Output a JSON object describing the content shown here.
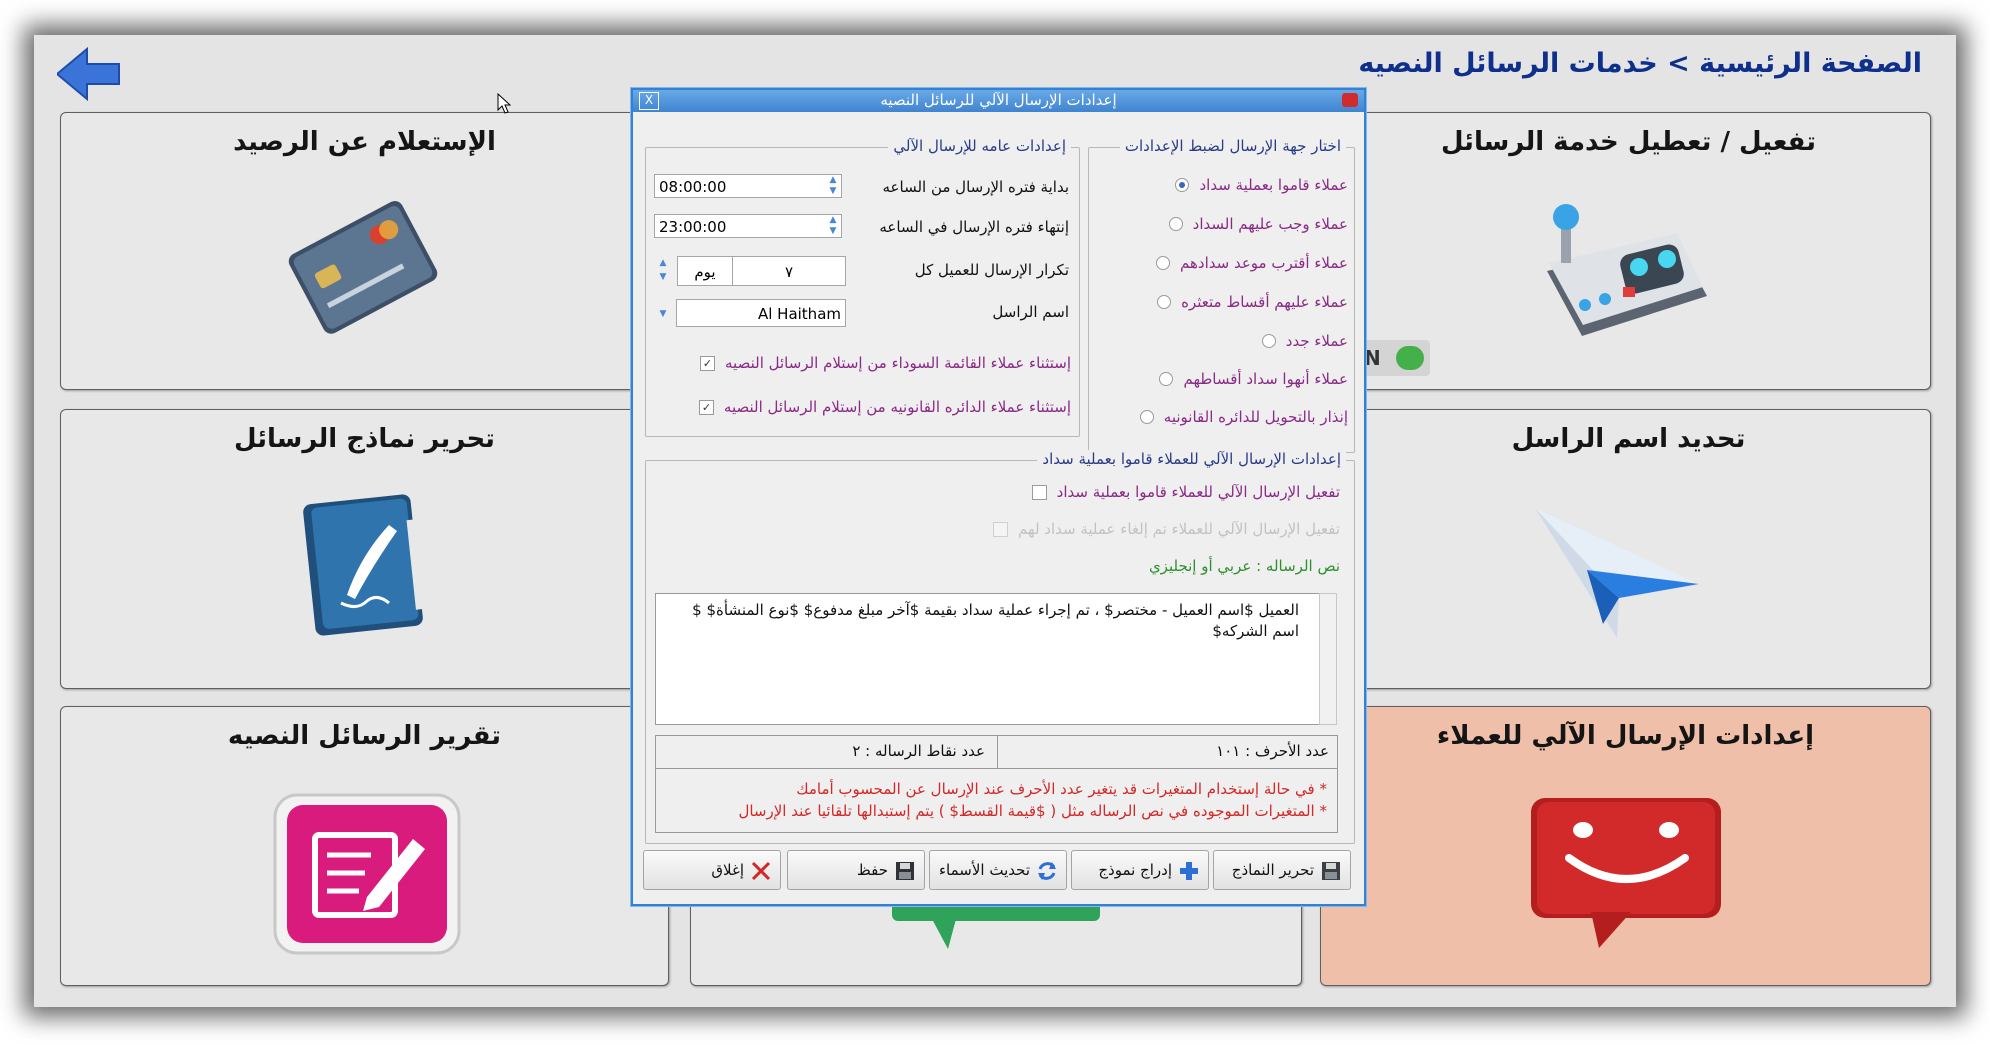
{
  "breadcrumb": "الصفحة الرئيسية > خدمات الرسائل النصيه",
  "tiles": {
    "balance": "الإستعلام عن الرصيد",
    "activate": "تفعيل / تعطيل خدمة الرسائل",
    "templates": "تحرير نماذج الرسائل",
    "sender": "تحديد اسم الراسل",
    "report": "تقرير الرسائل النصيه",
    "auto": "إعدادات الإرسال الآلي للعملاء"
  },
  "toggle_letter": "N",
  "dialog": {
    "title": "إعدادات الإرسال الآلي للرسائل النصيه",
    "close_glyph": "X",
    "target_group": {
      "legend": "اختار جهة الإرسال لضبط الإعدادات",
      "options": [
        {
          "label": "عملاء قاموا بعملية سداد",
          "selected": true
        },
        {
          "label": "عملاء وجب عليهم السداد",
          "selected": false
        },
        {
          "label": "عملاء أقترب موعد سدادهم",
          "selected": false
        },
        {
          "label": "عملاء عليهم أقساط متعثره",
          "selected": false
        },
        {
          "label": "عملاء جدد",
          "selected": false
        },
        {
          "label": "عملاء أنهوا سداد أقساطهم",
          "selected": false
        },
        {
          "label": "إنذار بالتحويل للدائره القانونيه",
          "selected": false
        }
      ]
    },
    "general_group": {
      "legend": "إعدادات عامه للإرسال الآلي",
      "start_label": "بداية فتره الإرسال من الساعه",
      "start_value": "08:00:00",
      "end_label": "إنتهاء فتره الإرسال في الساعه",
      "end_value": "23:00:00",
      "repeat_label": "تكرار الإرسال للعميل كل",
      "repeat_value": "٧",
      "repeat_unit": "يوم",
      "sender_label": "اسم الراسل",
      "sender_value": "Al Haitham",
      "exclude_blacklist": "إستثناء عملاء القائمة السوداء من إستلام الرسائل النصيه",
      "exclude_blacklist_checked": true,
      "exclude_legal": "إستثناء عملاء الدائره القانونيه من إستلام الرسائل النصيه",
      "exclude_legal_checked": true
    },
    "paid_group": {
      "legend": "إعدادات الإرسال الآلي للعملاء قاموا بعملية سداد",
      "enable_label": "تفعيل الإرسال الآلي للعملاء قاموا بعملية سداد",
      "enable_checked": false,
      "cancel_label": "تفعيل الإرسال الآلي للعملاء تم إلغاء عملية سداد لهم",
      "cancel_checked": false,
      "message_lang_label": "نص الرساله : عربي أو إنجليزي",
      "message_text": "العميل $اسم العميل - مختصر$ ، تم إجراء عملية سداد بقيمة $آخر مبلغ مدفوع$ $نوع المنشأة$ $ اسم الشركه$"
    },
    "char_count": "عدد الأحرف : ١٠١",
    "points_count": "عدد نقاط الرساله : ٢",
    "notes": [
      "* في حالة إستخدام المتغيرات قد يتغير عدد الأحرف عند الإرسال عن المحسوب أمامك",
      "* المتغيرات الموجوده في نص الرساله مثل ( $قيمة القسط$ ) يتم إستبدالها تلقائيا عند الإرسال"
    ],
    "buttons": {
      "edit_templates": "تحرير النماذج",
      "insert_template": "إدراج نموذج",
      "refresh_names": "تحديث الأسماء",
      "save": "حفظ",
      "close": "إغلاق"
    }
  },
  "colors": {
    "title_blue": "#0e2f8c",
    "option_purple": "#8a2a86",
    "legend_blue": "#2a3b86",
    "note_red": "#d22828",
    "green_text": "#2f8f2f",
    "active_tile": "#efbfa9"
  }
}
